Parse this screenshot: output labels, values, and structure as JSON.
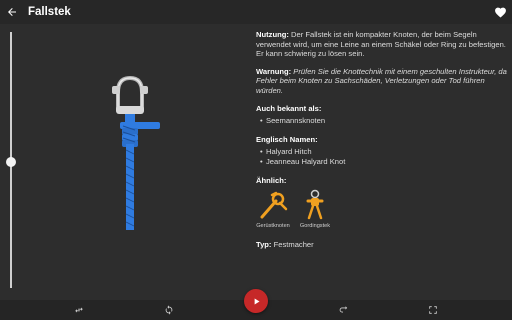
{
  "header": {
    "title": "Fallstek",
    "back_icon": "arrow-back-icon",
    "favorite_icon": "heart-icon"
  },
  "info": {
    "usage_label": "Nutzung:",
    "usage_text": "Der Fallstek ist ein kompakter Knoten, der beim Segeln verwendet wird, um eine Leine an einem Schäkel oder Ring zu befestigen. Er kann schwierig zu lösen sein.",
    "warning_label": "Warnung:",
    "warning_text": "Prüfen Sie die Knottechnik mit einem geschulten Instrukteur, da Fehler beim Knoten zu Sachschäden, Verletzungen oder Tod führen würden.",
    "aka_title": "Auch bekannt als:",
    "aka_items": [
      "Seemannsknoten"
    ],
    "english_title": "Englisch Namen:",
    "english_items": [
      "Halyard Hitch",
      "Jeanneau Halyard Knot"
    ],
    "similar_title": "Ähnlich:",
    "similar_items": [
      {
        "label": "Gerüstknoten"
      },
      {
        "label": "Gordingstek"
      }
    ],
    "type_label": "Typ:",
    "type_value": "Festmacher"
  },
  "slider": {
    "value_fraction": 0.5
  },
  "bottom_bar": {
    "icons": [
      "swap-horiz-icon",
      "rotate-icon",
      "play-icon",
      "flip-icon",
      "fullscreen-icon"
    ]
  },
  "colors": {
    "rope": "#2f7be0",
    "play_button": "#c62828",
    "similar_rope": "#f0a020"
  }
}
